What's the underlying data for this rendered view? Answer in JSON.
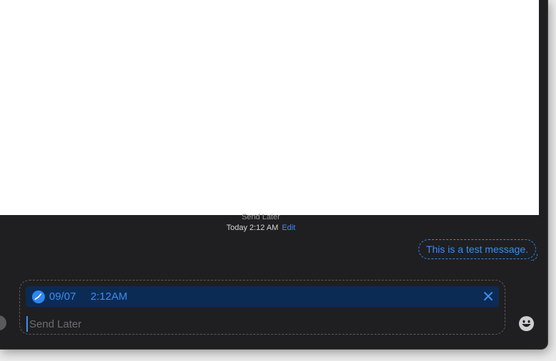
{
  "scheduled_info": {
    "label": "Send Later",
    "when": "Today 2:12 AM",
    "edit_label": "Edit"
  },
  "message_bubble": {
    "text": "This is a test message."
  },
  "compose": {
    "schedule": {
      "icon": "clock-icon",
      "date": "09/07",
      "time": "2:12AM",
      "close_icon": "close-icon"
    },
    "input": {
      "value": "",
      "placeholder": "Send Later"
    },
    "emoji_icon": "emoji-icon",
    "apps_icon": "apps-button"
  },
  "colors": {
    "accent": "#3b8ef0",
    "schedule_bar_bg": "#0c2b54",
    "window_bg": "#1f1f21",
    "content_bg": "#ffffff"
  }
}
